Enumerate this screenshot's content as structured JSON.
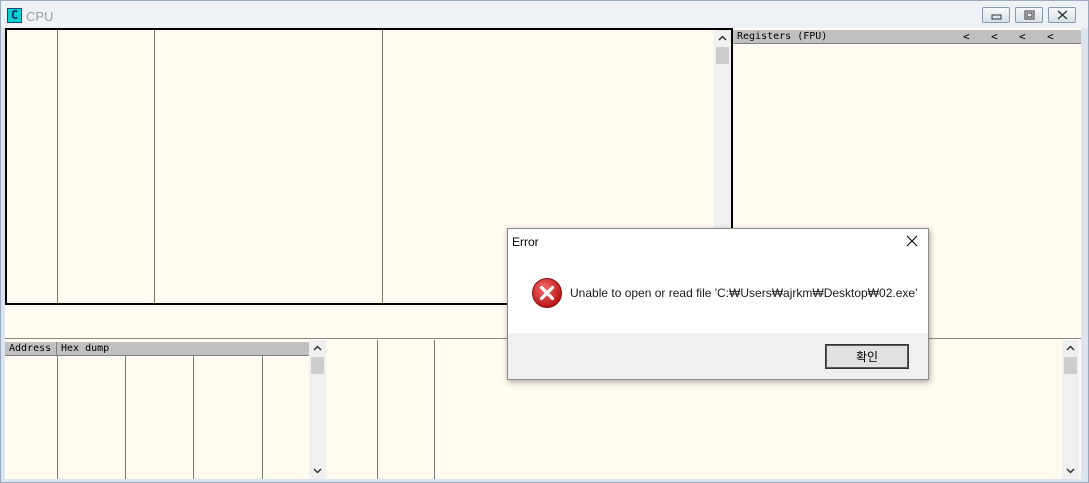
{
  "window": {
    "icon_letter": "C",
    "title": "CPU",
    "buttons": [
      "minimize",
      "restore",
      "close"
    ]
  },
  "registers": {
    "header": "Registers (FPU)",
    "arrows": [
      "<",
      "<",
      "<",
      "<"
    ]
  },
  "dump": {
    "headers": [
      "Address",
      "Hex dump"
    ]
  },
  "dialog": {
    "title": "Error",
    "message": "Unable to open or read file 'C:₩Users₩ajrkm₩Desktop₩02.exe'",
    "ok_label": "확인",
    "icon": "error-icon"
  },
  "colors": {
    "pane_bg": "#fffbf0",
    "error_red": "#d21b1b"
  }
}
